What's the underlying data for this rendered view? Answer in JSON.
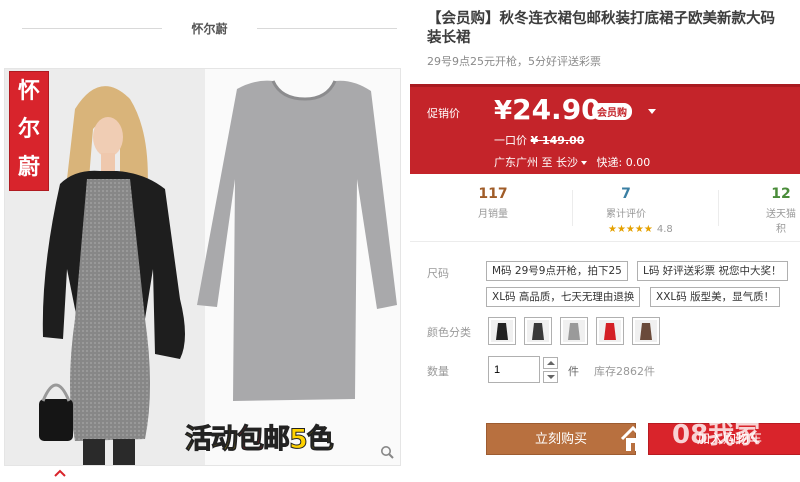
{
  "gallery": {
    "brand": "怀尔蔚",
    "logo_chars": [
      "怀",
      "尔",
      "蔚"
    ],
    "promo": {
      "part1": "活动",
      "part2": "包邮",
      "part3": "5色"
    }
  },
  "product": {
    "title_line1": "【会员购】秋冬连衣裙包邮秋装打底裙子欧美新款大码",
    "title_line2": "装长裙",
    "subtitle": "29号9点25元开枪，5分好评送彩票"
  },
  "price": {
    "label": "促销价",
    "currency": "¥",
    "amount": "24.90",
    "badge": "会员购",
    "orig_label": "一口价",
    "orig_value": "¥ 149.00",
    "ship_from": "广东广州",
    "ship_to_word": "至",
    "ship_city": "长沙",
    "ship_fee": "快递: 0.00"
  },
  "stats": [
    {
      "num": "117",
      "label": "月销量"
    },
    {
      "num": "7",
      "label": "累计评价"
    },
    {
      "num": "12",
      "label": "送天猫积"
    }
  ],
  "rating": {
    "stars": "★★★★★",
    "score": "4.8"
  },
  "options": {
    "size_label": "尺码",
    "sizes": [
      "M码 29号9点开枪，拍下25",
      "L码 好评送彩票 祝您中大奖！",
      "XL码 高品质，七天无理由退换",
      "XXL码 版型美，显气质！"
    ],
    "color_label": "颜色分类",
    "colors": [
      "#222222",
      "#3a3a3a",
      "#9a9a9a",
      "#d42026",
      "#6a4a3a"
    ],
    "qty_label": "数量",
    "qty_value": "1",
    "qty_unit": "件",
    "stock": "库存2862件"
  },
  "actions": {
    "buy": "立刻购买",
    "cart": "加入购物车"
  },
  "watermark": "08我家"
}
